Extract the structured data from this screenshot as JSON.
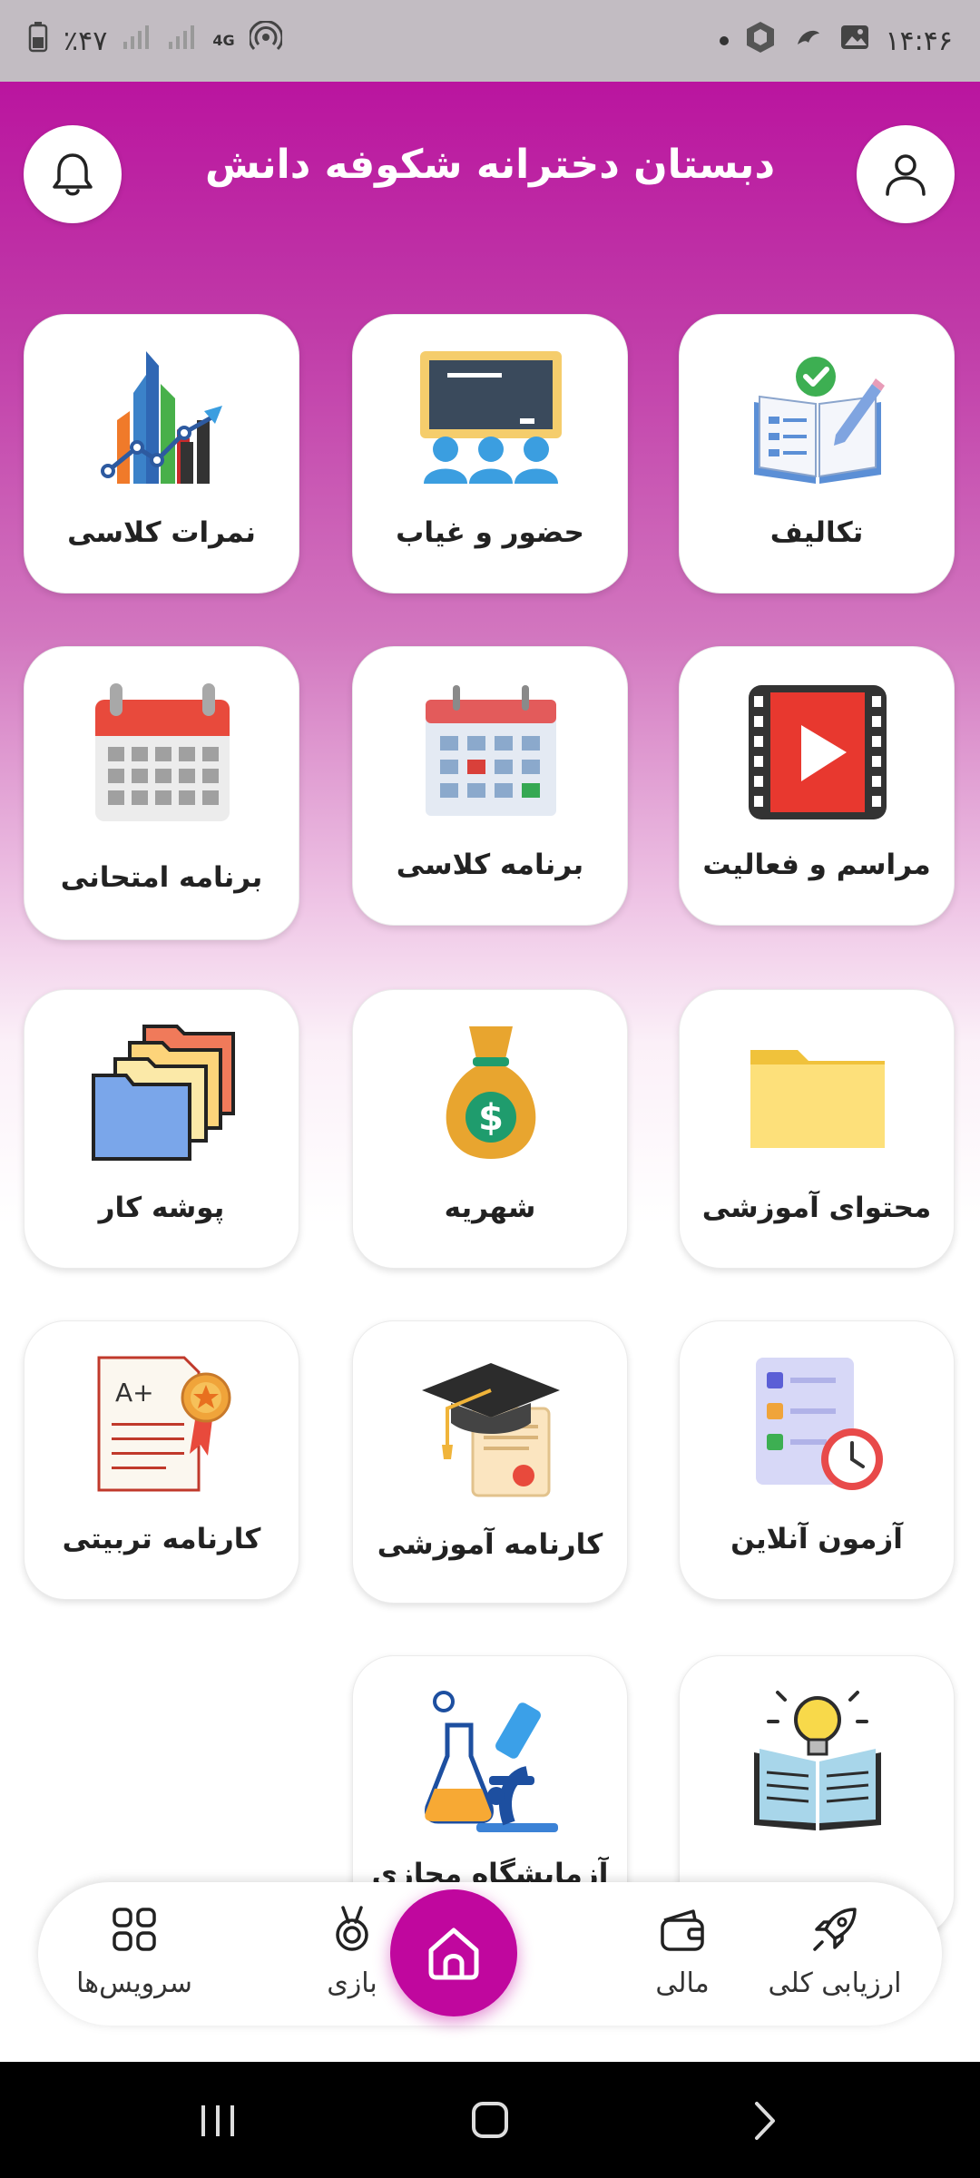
{
  "status_bar": {
    "time": "۱۴:۴۶",
    "battery": "٪۴۷",
    "network": "4G"
  },
  "header": {
    "title": "دبستان دخترانه شکوفه دانش",
    "left_icon": "bell-icon",
    "right_icon": "user-icon"
  },
  "tiles": [
    {
      "label": "تکالیف",
      "icon": "homework-book-icon"
    },
    {
      "label": "حضور و غیاب",
      "icon": "attendance-class-icon"
    },
    {
      "label": "نمرات کلاسی",
      "icon": "grades-chart-icon"
    },
    {
      "label": "مراسم و فعالیت",
      "icon": "video-play-icon"
    },
    {
      "label": "برنامه کلاسی",
      "icon": "class-calendar-icon"
    },
    {
      "label": "برنامه امتحانی",
      "icon": "exam-calendar-icon"
    },
    {
      "label": "محتوای آموزشی",
      "icon": "folder-icon"
    },
    {
      "label": "شهریه",
      "icon": "money-bag-icon"
    },
    {
      "label": "پوشه کار",
      "icon": "stacked-folders-icon"
    },
    {
      "label": "آزمون آنلاین",
      "icon": "online-exam-icon"
    },
    {
      "label": "کارنامه آموزشی",
      "icon": "graduation-cap-icon"
    },
    {
      "label": "کارنامه تربیتی",
      "icon": "certificate-icon"
    },
    {
      "label": "",
      "icon": "bulb-book-icon"
    },
    {
      "label": "آزمایشگاه مجازی",
      "icon": "lab-microscope-icon"
    }
  ],
  "bottom_nav": {
    "items": [
      {
        "label": "ارزیابی کلی",
        "icon": "rocket-icon"
      },
      {
        "label": "مالی",
        "icon": "wallet-icon"
      },
      {
        "label": "",
        "icon": "home-icon"
      },
      {
        "label": "بازی",
        "icon": "medal-icon"
      },
      {
        "label": "سرویس‌ها",
        "icon": "services-grid-icon"
      }
    ]
  },
  "colors": {
    "primary": "#c0079e",
    "status_bar_bg": "#c2bcc2",
    "system_nav_bg": "#000000"
  }
}
